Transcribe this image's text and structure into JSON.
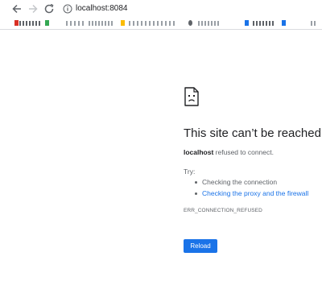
{
  "browser": {
    "url": "localhost:8084",
    "icons": {
      "back": "arrow-left-icon",
      "forward": "arrow-right-icon",
      "reload": "reload-icon",
      "site_info": "info-icon"
    }
  },
  "error_page": {
    "title": "This site can’t be reached",
    "host": "localhost",
    "message_suffix": " refused to connect.",
    "try_label": "Try:",
    "suggestions": [
      {
        "label": "Checking the connection",
        "is_link": false
      },
      {
        "label": "Checking the proxy and the firewall",
        "is_link": true
      }
    ],
    "error_code": "ERR_CONNECTION_REFUSED",
    "reload_button": "Reload",
    "icon": "sad-page-icon"
  },
  "colors": {
    "accent": "#1a73e8",
    "text_primary": "#202124",
    "text_secondary": "#5f6368"
  }
}
